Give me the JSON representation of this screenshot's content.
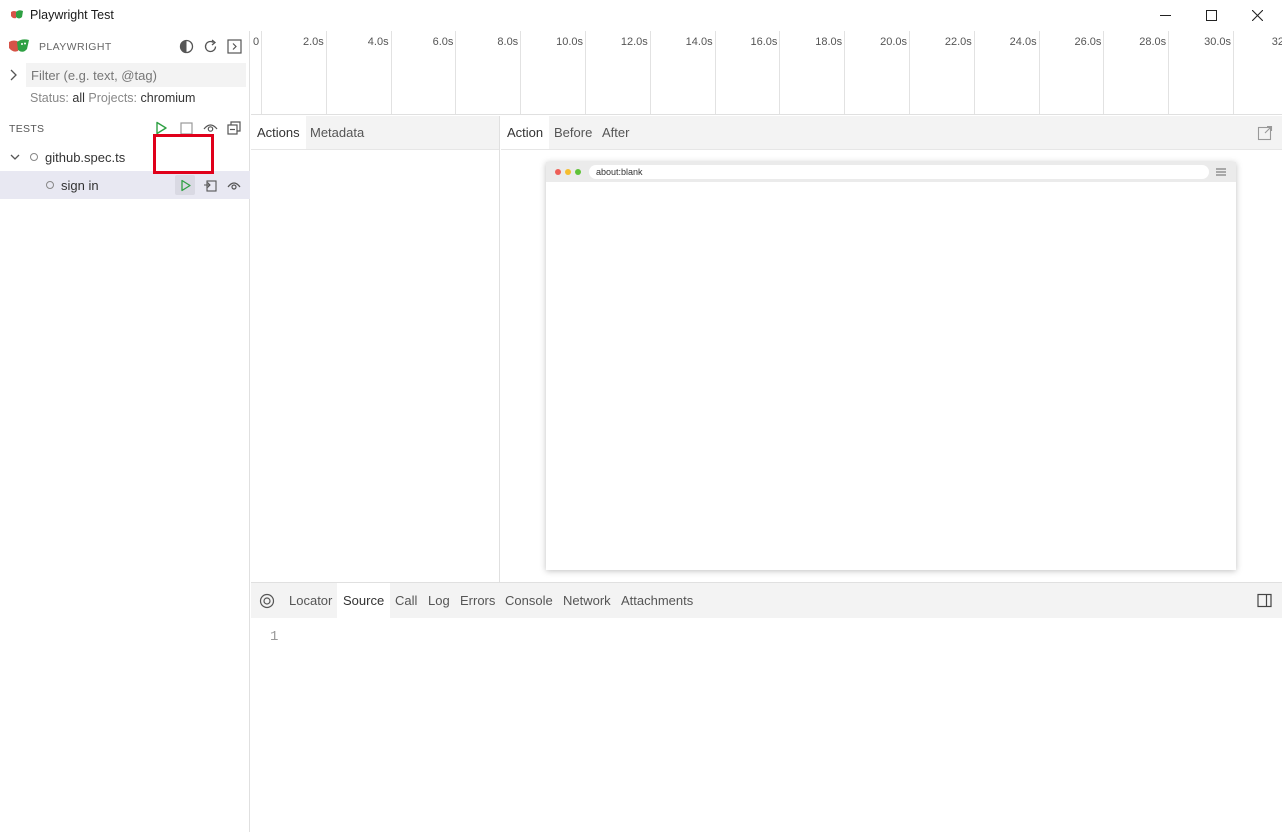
{
  "window": {
    "title": "Playwright Test",
    "controls": [
      "minimize-icon",
      "maximize-icon",
      "close-icon"
    ]
  },
  "sidebar": {
    "brand": "PLAYWRIGHT",
    "header_icons": [
      "theme-toggle-icon",
      "reload-icon",
      "toggle-output-icon"
    ],
    "filter": {
      "placeholder": "Filter (e.g. text, @tag)",
      "value": ""
    },
    "status_label": "Status:",
    "status_value": "all",
    "projects_label": "Projects:",
    "projects_value": "chromium",
    "tests_label": "TESTS",
    "tests_icons": [
      "run-all-icon",
      "stop-icon",
      "watch-all-icon",
      "collapse-all-icon"
    ],
    "tree": [
      {
        "label": "github.spec.ts",
        "expanded": true
      },
      {
        "label": "sign in",
        "selected": true,
        "actions": [
          "run-icon",
          "go-to-source-icon",
          "watch-icon"
        ]
      }
    ]
  },
  "timeline": {
    "ticks": [
      "0",
      "2.0s",
      "4.0s",
      "6.0s",
      "8.0s",
      "10.0s",
      "12.0s",
      "14.0s",
      "16.0s",
      "18.0s",
      "20.0s",
      "22.0s",
      "24.0s",
      "26.0s",
      "28.0s",
      "30.0s",
      "32"
    ]
  },
  "actions_panel": {
    "tabs": [
      "Actions",
      "Metadata"
    ],
    "active_tab": "Actions"
  },
  "snapshot_panel": {
    "tabs": [
      "Action",
      "Before",
      "After"
    ],
    "active_tab": "Action",
    "url": "about:blank",
    "dot_colors": [
      "#ee5f57",
      "#f5bd2f",
      "#5fc238"
    ]
  },
  "bottom_panel": {
    "tabs": [
      "Locator",
      "Source",
      "Call",
      "Log",
      "Errors",
      "Console",
      "Network",
      "Attachments"
    ],
    "active_tab": "Source",
    "source_line": "1"
  },
  "colors": {
    "accent_green": "#2ea043",
    "highlight_red": "#e0001a",
    "selected_row": "#e8e8f2"
  }
}
